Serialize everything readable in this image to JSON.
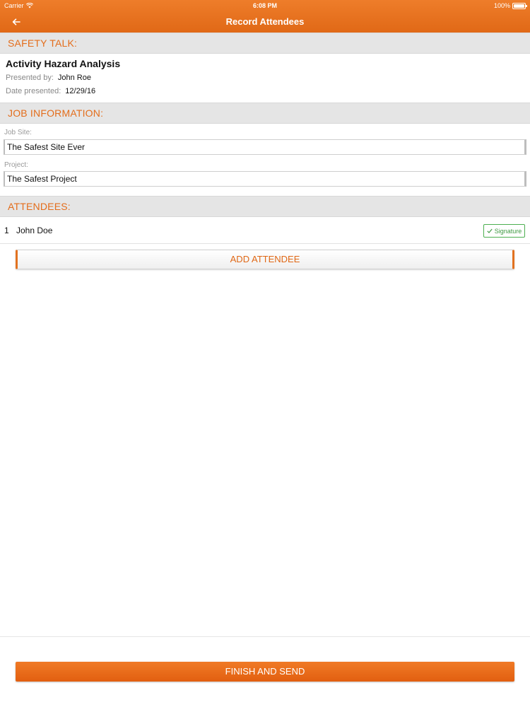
{
  "status_bar": {
    "carrier": "Carrier",
    "time": "6:08 PM",
    "battery": "100%"
  },
  "nav": {
    "title": "Record Attendees",
    "back_icon": "arrow-left-icon"
  },
  "safety_talk": {
    "header": "SAFETY TALK:",
    "title": "Activity Hazard Analysis",
    "presented_by_label": "Presented by:",
    "presented_by_value": "John Roe",
    "date_label": "Date presented:",
    "date_value": "12/29/16"
  },
  "job_information": {
    "header": "JOB INFORMATION:",
    "job_site_label": "Job Site:",
    "job_site_value": "The Safest Site Ever",
    "project_label": "Project:",
    "project_value": "The Safest Project"
  },
  "attendees": {
    "header": "ATTENDEES:",
    "items": [
      {
        "number": "1",
        "name": "John Doe",
        "signature_label": "Signature"
      }
    ],
    "add_button_label": "ADD ATTENDEE"
  },
  "footer": {
    "finish_button_label": "FINISH AND SEND"
  },
  "colors": {
    "accent": "#e8731f",
    "header_bg": "#e5e5e5",
    "signature_green": "#4caf50"
  }
}
